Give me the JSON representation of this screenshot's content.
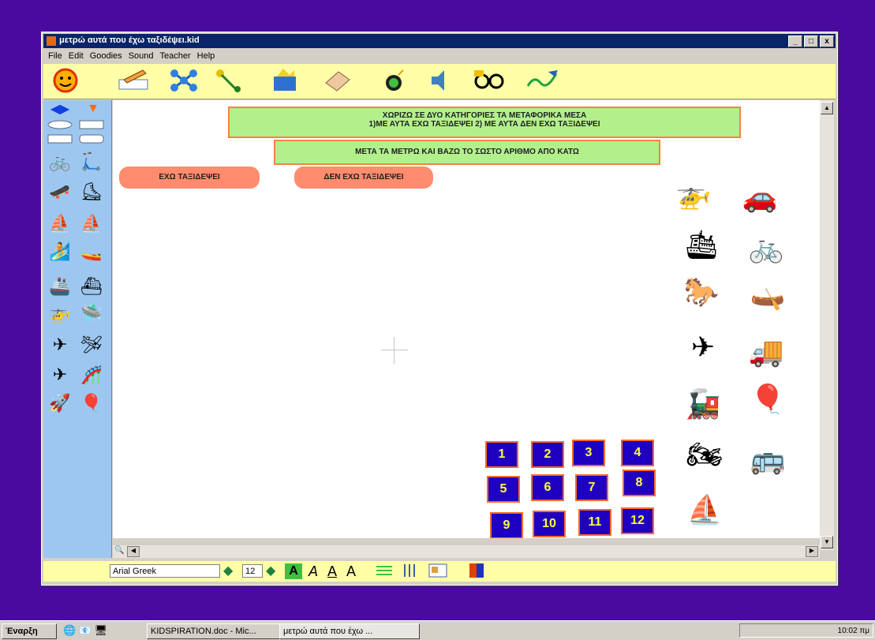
{
  "window": {
    "title": "μετρώ αυτά που έχω ταξιδέψει.kid",
    "buttons": [
      "_",
      "□",
      "x"
    ]
  },
  "menu": [
    "File",
    "Edit",
    "Goodies",
    "Sound",
    "Teacher",
    "Help"
  ],
  "toolbar_icons": [
    "sun-face-icon",
    "pencil-icon",
    "diagram-icon",
    "link-icon",
    "bucket-icon",
    "eraser-icon",
    "bomb-icon",
    "sound-icon",
    "glasses-icon",
    "pen-icon"
  ],
  "canvas": {
    "header1_line1": "ΧΩΡΙΖΩ ΣΕ ΔΥΟ ΚΑΤΗΓΟΡΙΕΣ ΤΑ ΜΕΤΑΦΟΡΙΚΑ ΜΕΣΑ",
    "header1_line2": "1)ΜΕ ΑΥΤΑ ΕΧΩ ΤΑΞΙΔΕΨΕΙ 2) ΜΕ ΑΥΤΑ ΔΕΝ ΕΧΩ ΤΑΞΙΔΕΨΕΙ",
    "header2": "ΜΕΤΑ ΤΑ ΜΕΤΡΩ ΚΑΙ ΒΑΖΩ ΤΟ ΣΩΣΤΟ ΑΡΙΘΜΟ ΑΠΟ ΚΑΤΩ",
    "pill_left": "ΕΧΩ ΤΑΞΙΔΕΨΕΙ",
    "pill_right": "ΔΕΝ ΕΧΩ ΤΑΞΙΔΕΨΕΙ",
    "numbers": [
      "1",
      "2",
      "3",
      "4",
      "5",
      "6",
      "7",
      "8",
      "9",
      "10",
      "11",
      "12"
    ]
  },
  "format": {
    "font": "Arial Greek",
    "size": "12"
  },
  "taskbar": {
    "start": "Έναρξη",
    "item1": "KIDSPIRATION.doc - Mic...",
    "item2": "μετρώ αυτά που έχω ...",
    "clock": "10:02 πμ"
  }
}
